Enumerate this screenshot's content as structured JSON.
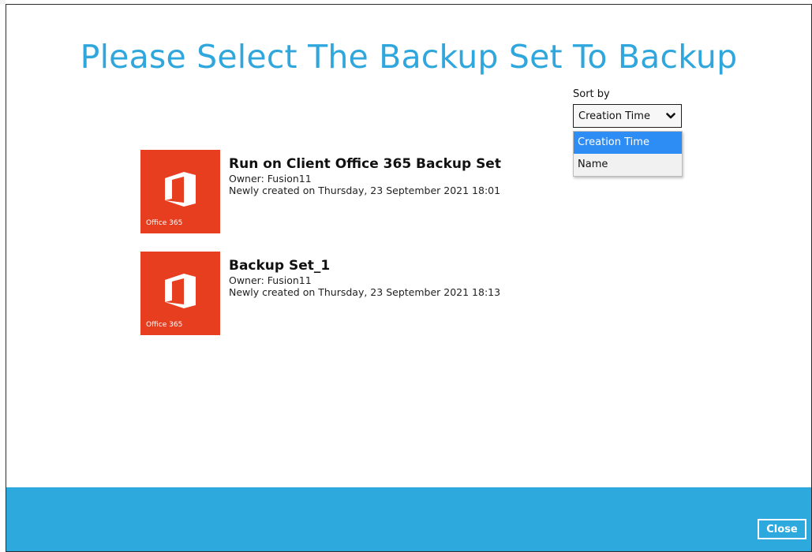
{
  "page": {
    "title": "Please Select The Backup Set To Backup"
  },
  "sort": {
    "label": "Sort by",
    "selected": "Creation Time",
    "options": [
      "Creation Time",
      "Name"
    ]
  },
  "backup_sets": [
    {
      "name": "Run on Client Office 365 Backup Set",
      "owner": "Owner: Fusion11",
      "created": "Newly created on Thursday, 23 September 2021 18:01",
      "tile_label": "Office 365",
      "icon": "office-365-icon"
    },
    {
      "name": "Backup Set_1",
      "owner": "Owner: Fusion11",
      "created": "Newly created on Thursday, 23 September 2021 18:13",
      "tile_label": "Office 365",
      "icon": "office-365-icon"
    }
  ],
  "footer": {
    "close_label": "Close"
  },
  "colors": {
    "accent": "#2fa7dd",
    "footer": "#2ea9de",
    "tile": "#e63e1f",
    "dropdown_highlight": "#2e8df5"
  }
}
